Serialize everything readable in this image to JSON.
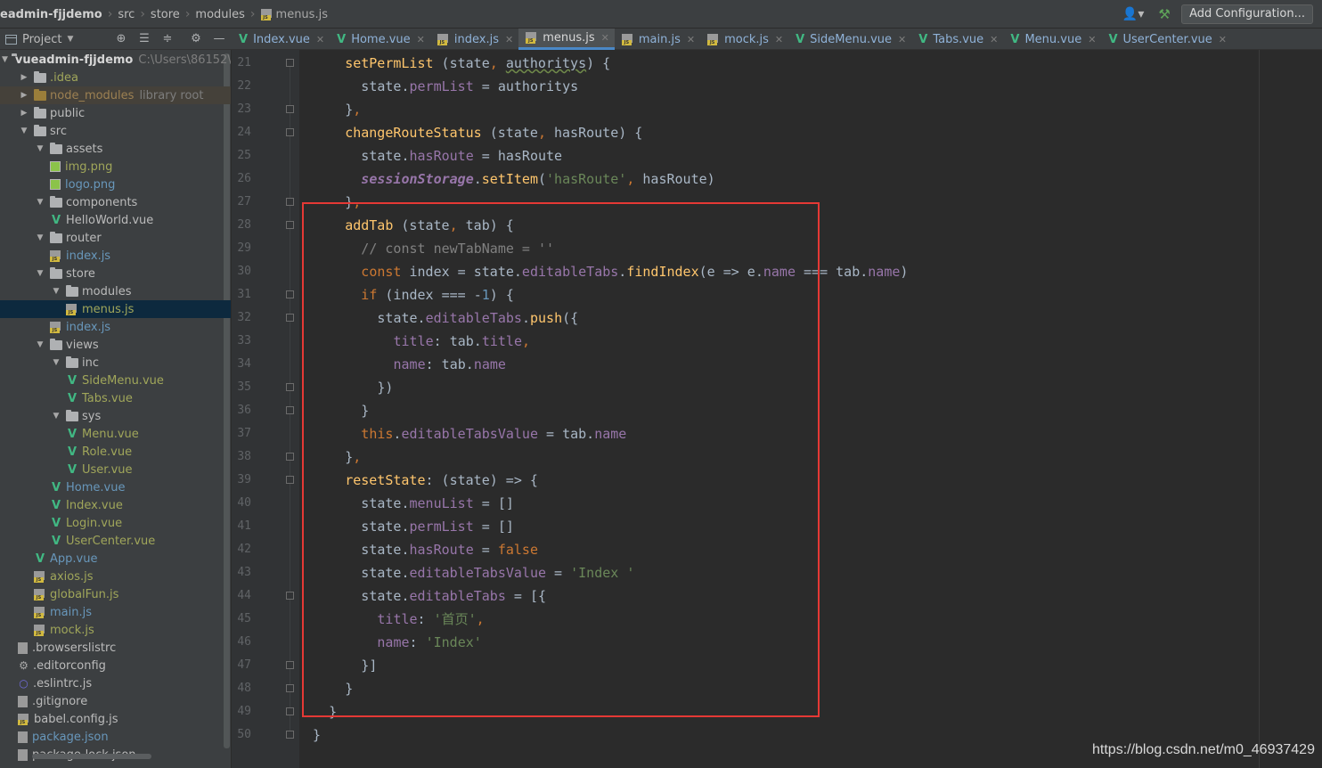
{
  "navbar": {
    "crumbs": [
      "eadmin-fjjdemo",
      "src",
      "store",
      "modules",
      "menus.js"
    ],
    "add_config_label": "Add Configuration..."
  },
  "project_panel": {
    "title": "Project"
  },
  "tabs": [
    {
      "label": "Index.vue",
      "type": "vue"
    },
    {
      "label": "Home.vue",
      "type": "vue"
    },
    {
      "label": "index.js",
      "type": "js"
    },
    {
      "label": "menus.js",
      "type": "js",
      "active": true
    },
    {
      "label": "main.js",
      "type": "js"
    },
    {
      "label": "mock.js",
      "type": "js"
    },
    {
      "label": "SideMenu.vue",
      "type": "vue"
    },
    {
      "label": "Tabs.vue",
      "type": "vue"
    },
    {
      "label": "Menu.vue",
      "type": "vue"
    },
    {
      "label": "UserCenter.vue",
      "type": "vue"
    }
  ],
  "tree": [
    {
      "label": "vueadmin-fjjdemo",
      "note": "C:\\Users\\86152\\w",
      "icon": "folder",
      "level": 0,
      "arrow": "open",
      "bold": true
    },
    {
      "label": ".idea",
      "icon": "folder",
      "level": 1,
      "arrow": "closed",
      "color": "olive"
    },
    {
      "label": "node_modules",
      "note": "library root",
      "icon": "folder-lib",
      "level": 1,
      "arrow": "closed",
      "color": "lib"
    },
    {
      "label": "public",
      "icon": "folder",
      "level": 1,
      "arrow": "closed"
    },
    {
      "label": "src",
      "icon": "folder",
      "level": 1,
      "arrow": "open"
    },
    {
      "label": "assets",
      "icon": "folder",
      "level": 2,
      "arrow": "open"
    },
    {
      "label": "img.png",
      "icon": "image",
      "level": 3,
      "color": "olive"
    },
    {
      "label": "logo.png",
      "icon": "image",
      "level": 3,
      "color": "blue"
    },
    {
      "label": "components",
      "icon": "folder",
      "level": 2,
      "arrow": "open"
    },
    {
      "label": "HelloWorld.vue",
      "icon": "vue",
      "level": 3
    },
    {
      "label": "router",
      "icon": "folder",
      "level": 2,
      "arrow": "open"
    },
    {
      "label": "index.js",
      "icon": "js",
      "level": 3,
      "color": "blue"
    },
    {
      "label": "store",
      "icon": "folder",
      "level": 2,
      "arrow": "open"
    },
    {
      "label": "modules",
      "icon": "folder",
      "level": 3,
      "arrow": "open"
    },
    {
      "label": "menus.js",
      "icon": "js",
      "level": 4,
      "color": "olive",
      "selected": true
    },
    {
      "label": "index.js",
      "icon": "js",
      "level": 3,
      "color": "blue"
    },
    {
      "label": "views",
      "icon": "folder",
      "level": 2,
      "arrow": "open"
    },
    {
      "label": "inc",
      "icon": "folder",
      "level": 3,
      "arrow": "open"
    },
    {
      "label": "SideMenu.vue",
      "icon": "vue",
      "level": 4,
      "color": "olive"
    },
    {
      "label": "Tabs.vue",
      "icon": "vue",
      "level": 4,
      "color": "olive"
    },
    {
      "label": "sys",
      "icon": "folder",
      "level": 3,
      "arrow": "open"
    },
    {
      "label": "Menu.vue",
      "icon": "vue",
      "level": 4,
      "color": "olive"
    },
    {
      "label": "Role.vue",
      "icon": "vue",
      "level": 4,
      "color": "olive"
    },
    {
      "label": "User.vue",
      "icon": "vue",
      "level": 4,
      "color": "olive"
    },
    {
      "label": "Home.vue",
      "icon": "vue",
      "level": 3,
      "color": "blue"
    },
    {
      "label": "Index.vue",
      "icon": "vue",
      "level": 3,
      "color": "olive"
    },
    {
      "label": "Login.vue",
      "icon": "vue",
      "level": 3,
      "color": "olive"
    },
    {
      "label": "UserCenter.vue",
      "icon": "vue",
      "level": 3,
      "color": "olive"
    },
    {
      "label": "App.vue",
      "icon": "vue",
      "level": 2,
      "color": "blue"
    },
    {
      "label": "axios.js",
      "icon": "js",
      "level": 2,
      "color": "olive"
    },
    {
      "label": "globalFun.js",
      "icon": "js",
      "level": 2,
      "color": "olive"
    },
    {
      "label": "main.js",
      "icon": "js",
      "level": 2,
      "color": "blue"
    },
    {
      "label": "mock.js",
      "icon": "js",
      "level": 2,
      "color": "olive"
    },
    {
      "label": ".browserslistrc",
      "icon": "file",
      "level": 1
    },
    {
      "label": ".editorconfig",
      "icon": "gear",
      "level": 1
    },
    {
      "label": ".eslintrc.js",
      "icon": "ring",
      "level": 1
    },
    {
      "label": ".gitignore",
      "icon": "file",
      "level": 1
    },
    {
      "label": "babel.config.js",
      "icon": "js",
      "level": 1
    },
    {
      "label": "package.json",
      "icon": "file",
      "level": 1,
      "color": "blue"
    },
    {
      "label": "package-lock.json",
      "icon": "file",
      "level": 1
    }
  ],
  "editor": {
    "lines": [
      {
        "num": "21",
        "indent": 2,
        "tokens": [
          [
            "fn",
            "setPermList"
          ],
          [
            "pl",
            " (state"
          ],
          [
            "kw",
            ","
          ],
          [
            "pl",
            " "
          ],
          [
            "und",
            "authoritys"
          ],
          [
            "pl",
            ") {"
          ]
        ]
      },
      {
        "num": "22",
        "indent": 3,
        "tokens": [
          [
            "pl",
            "state."
          ],
          [
            "prop",
            "permList"
          ],
          [
            "pl",
            " = authoritys"
          ]
        ]
      },
      {
        "num": "23",
        "indent": 2,
        "tokens": [
          [
            "pl",
            "}"
          ],
          [
            "kw",
            ","
          ]
        ]
      },
      {
        "num": "24",
        "indent": 2,
        "tokens": [
          [
            "fn",
            "changeRouteStatus"
          ],
          [
            "pl",
            " (state"
          ],
          [
            "kw",
            ","
          ],
          [
            "pl",
            " hasRoute) {"
          ]
        ]
      },
      {
        "num": "25",
        "indent": 3,
        "tokens": [
          [
            "pl",
            "state."
          ],
          [
            "prop",
            "hasRoute"
          ],
          [
            "pl",
            " = hasRoute"
          ]
        ]
      },
      {
        "num": "26",
        "indent": 3,
        "tokens": [
          [
            "global",
            "sessionStorage"
          ],
          [
            "pl",
            "."
          ],
          [
            "fn",
            "setItem"
          ],
          [
            "pl",
            "("
          ],
          [
            "str",
            "'hasRoute'"
          ],
          [
            "kw",
            ","
          ],
          [
            "pl",
            " hasRoute)"
          ]
        ]
      },
      {
        "num": "27",
        "indent": 2,
        "tokens": [
          [
            "pl",
            "}"
          ],
          [
            "kw",
            ","
          ]
        ]
      },
      {
        "num": "28",
        "indent": 2,
        "tokens": [
          [
            "fn",
            "addTab"
          ],
          [
            "pl",
            " (state"
          ],
          [
            "kw",
            ","
          ],
          [
            "pl",
            " tab) {"
          ]
        ]
      },
      {
        "num": "29",
        "indent": 3,
        "tokens": [
          [
            "cm",
            "// const newTabName = ''"
          ]
        ]
      },
      {
        "num": "30",
        "indent": 3,
        "tokens": [
          [
            "kw",
            "const "
          ],
          [
            "pl",
            "index = state."
          ],
          [
            "prop",
            "editableTabs"
          ],
          [
            "pl",
            "."
          ],
          [
            "fn",
            "findIndex"
          ],
          [
            "pl",
            "(e => e."
          ],
          [
            "prop",
            "name"
          ],
          [
            "pl",
            " === tab."
          ],
          [
            "prop",
            "name"
          ],
          [
            "pl",
            ")"
          ]
        ]
      },
      {
        "num": "31",
        "indent": 3,
        "tokens": [
          [
            "kw",
            "if "
          ],
          [
            "pl",
            "(index === -"
          ],
          [
            "num",
            "1"
          ],
          [
            "pl",
            ") {"
          ]
        ]
      },
      {
        "num": "32",
        "indent": 4,
        "tokens": [
          [
            "pl",
            "state."
          ],
          [
            "prop",
            "editableTabs"
          ],
          [
            "pl",
            "."
          ],
          [
            "fn",
            "push"
          ],
          [
            "pl",
            "({"
          ]
        ]
      },
      {
        "num": "33",
        "indent": 5,
        "tokens": [
          [
            "prop",
            "title"
          ],
          [
            "pl",
            ": tab."
          ],
          [
            "prop",
            "title"
          ],
          [
            "kw",
            ","
          ]
        ]
      },
      {
        "num": "34",
        "indent": 5,
        "tokens": [
          [
            "prop",
            "name"
          ],
          [
            "pl",
            ": tab."
          ],
          [
            "prop",
            "name"
          ]
        ]
      },
      {
        "num": "35",
        "indent": 4,
        "tokens": [
          [
            "pl",
            "})"
          ]
        ]
      },
      {
        "num": "36",
        "indent": 3,
        "tokens": [
          [
            "pl",
            "}"
          ]
        ]
      },
      {
        "num": "37",
        "indent": 3,
        "tokens": [
          [
            "kw",
            "this"
          ],
          [
            "pl",
            "."
          ],
          [
            "prop",
            "editableTabsValue"
          ],
          [
            "pl",
            " = tab."
          ],
          [
            "prop",
            "name"
          ]
        ]
      },
      {
        "num": "38",
        "indent": 2,
        "tokens": [
          [
            "pl",
            "}"
          ],
          [
            "kw",
            ","
          ]
        ]
      },
      {
        "num": "39",
        "indent": 2,
        "tokens": [
          [
            "fn",
            "resetState"
          ],
          [
            "pl",
            ": (state) => {"
          ]
        ]
      },
      {
        "num": "40",
        "indent": 3,
        "tokens": [
          [
            "pl",
            "state."
          ],
          [
            "prop",
            "menuList"
          ],
          [
            "pl",
            " = []"
          ]
        ]
      },
      {
        "num": "41",
        "indent": 3,
        "tokens": [
          [
            "pl",
            "state."
          ],
          [
            "prop",
            "permList"
          ],
          [
            "pl",
            " = []"
          ]
        ]
      },
      {
        "num": "42",
        "indent": 3,
        "tokens": [
          [
            "pl",
            "state."
          ],
          [
            "prop",
            "hasRoute"
          ],
          [
            "pl",
            " = "
          ],
          [
            "kw",
            "false"
          ]
        ]
      },
      {
        "num": "43",
        "indent": 3,
        "tokens": [
          [
            "pl",
            "state."
          ],
          [
            "prop",
            "editableTabsValue"
          ],
          [
            "pl",
            " = "
          ],
          [
            "str",
            "'Index '"
          ]
        ]
      },
      {
        "num": "44",
        "indent": 3,
        "tokens": [
          [
            "pl",
            "state."
          ],
          [
            "prop",
            "editableTabs"
          ],
          [
            "pl",
            " = [{"
          ]
        ]
      },
      {
        "num": "45",
        "indent": 4,
        "tokens": [
          [
            "prop",
            "title"
          ],
          [
            "pl",
            ": "
          ],
          [
            "str",
            "'首页'"
          ],
          [
            "kw",
            ","
          ]
        ]
      },
      {
        "num": "46",
        "indent": 4,
        "tokens": [
          [
            "prop",
            "name"
          ],
          [
            "pl",
            ": "
          ],
          [
            "str",
            "'Index'"
          ]
        ]
      },
      {
        "num": "47",
        "indent": 3,
        "tokens": [
          [
            "pl",
            "}]"
          ]
        ]
      },
      {
        "num": "48",
        "indent": 2,
        "tokens": [
          [
            "pl",
            "}"
          ]
        ]
      },
      {
        "num": "49",
        "indent": 1,
        "tokens": [
          [
            "pl",
            "}"
          ]
        ]
      },
      {
        "num": "50",
        "indent": 0,
        "tokens": [
          [
            "pl",
            "}"
          ]
        ]
      }
    ]
  },
  "watermark": "https://blog.csdn.net/m0_46937429",
  "colors": {
    "accent": "#4a88c7",
    "highlight_box": "#e53935",
    "vue": "#41b883"
  }
}
